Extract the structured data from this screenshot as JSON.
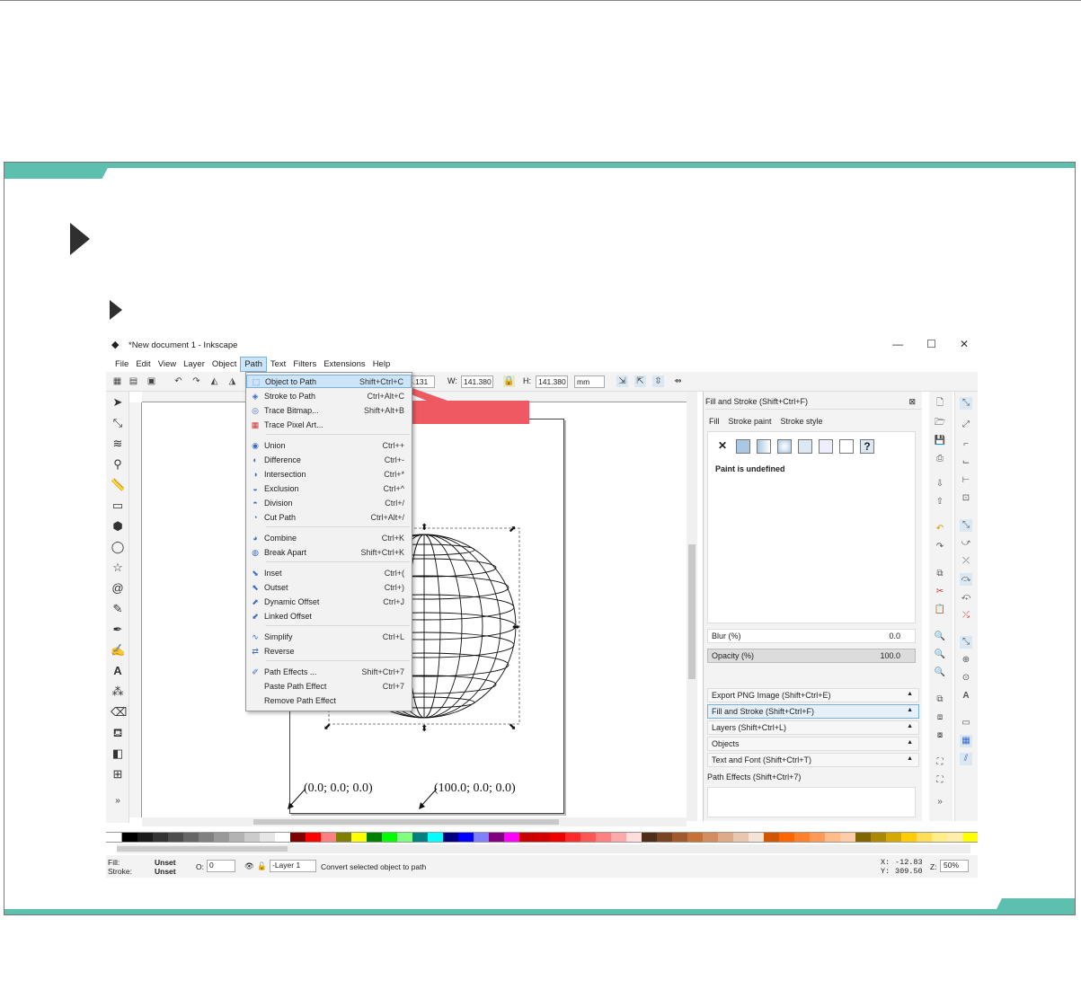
{
  "window": {
    "title": "*New document 1 - Inkscape",
    "controls": [
      "—",
      "☐",
      "✕"
    ]
  },
  "menubar": [
    "File",
    "Edit",
    "View",
    "Layer",
    "Object",
    "Path",
    "Text",
    "Filters",
    "Extensions",
    "Help"
  ],
  "toolbar": {
    "x_value": "5.131",
    "w_label": "W:",
    "w_value": "141.380",
    "h_label": "H:",
    "h_value": "141.380",
    "unit": "mm"
  },
  "path_menu": {
    "items": [
      {
        "label": "Object to Path",
        "shortcut": "Shift+Ctrl+C",
        "icon": "object-to-path-icon",
        "highlighted": true
      },
      {
        "label": "Stroke to Path",
        "shortcut": "Ctrl+Alt+C",
        "icon": "stroke-to-path-icon"
      },
      {
        "label": "Trace Bitmap...",
        "shortcut": "Shift+Alt+B",
        "icon": "trace-bitmap-icon"
      },
      {
        "label": "Trace Pixel Art...",
        "shortcut": "",
        "icon": "trace-pixel-art-icon"
      },
      {
        "label": "Union",
        "shortcut": "Ctrl++",
        "icon": "union-icon"
      },
      {
        "label": "Difference",
        "shortcut": "Ctrl+-",
        "icon": "difference-icon"
      },
      {
        "label": "Intersection",
        "shortcut": "Ctrl+*",
        "icon": "intersection-icon"
      },
      {
        "label": "Exclusion",
        "shortcut": "Ctrl+^",
        "icon": "exclusion-icon"
      },
      {
        "label": "Division",
        "shortcut": "Ctrl+/",
        "icon": "division-icon"
      },
      {
        "label": "Cut Path",
        "shortcut": "Ctrl+Alt+/",
        "icon": "cut-path-icon"
      },
      {
        "label": "Combine",
        "shortcut": "Ctrl+K",
        "icon": "combine-icon"
      },
      {
        "label": "Break Apart",
        "shortcut": "Shift+Ctrl+K",
        "icon": "break-apart-icon"
      },
      {
        "label": "Inset",
        "shortcut": "Ctrl+(",
        "icon": "inset-icon"
      },
      {
        "label": "Outset",
        "shortcut": "Ctrl+)",
        "icon": "outset-icon"
      },
      {
        "label": "Dynamic Offset",
        "shortcut": "Ctrl+J",
        "icon": "dynamic-offset-icon"
      },
      {
        "label": "Linked Offset",
        "shortcut": "",
        "icon": "linked-offset-icon"
      },
      {
        "label": "Simplify",
        "shortcut": "Ctrl+L",
        "icon": "simplify-icon"
      },
      {
        "label": "Reverse",
        "shortcut": "",
        "icon": "reverse-icon"
      },
      {
        "label": "Path Effects ...",
        "shortcut": "Shift+Ctrl+7",
        "icon": "path-effects-icon"
      },
      {
        "label": "Paste Path Effect",
        "shortcut": "Ctrl+7",
        "icon": ""
      },
      {
        "label": "Remove Path Effect",
        "shortcut": "",
        "icon": ""
      }
    ]
  },
  "canvas": {
    "coord_left": "(0.0; 0.0; 0.0)",
    "coord_right": "(100.0; 0.0; 0.0)"
  },
  "fill_stroke_panel": {
    "header": "Fill and Stroke (Shift+Ctrl+F)",
    "tabs": [
      "Fill",
      "Stroke paint",
      "Stroke style"
    ],
    "paint_status": "Paint is undefined",
    "blur_label": "Blur (%)",
    "blur_value": "0.0",
    "opacity_label": "Opacity (%)",
    "opacity_value": "100.0"
  },
  "docked_dialogs": [
    {
      "label": "Export PNG Image (Shift+Ctrl+E)",
      "active": false
    },
    {
      "label": "Fill and Stroke (Shift+Ctrl+F)",
      "active": true
    },
    {
      "label": "Layers (Shift+Ctrl+L)",
      "active": false
    },
    {
      "label": "Objects",
      "active": false
    },
    {
      "label": "Text and Font (Shift+Ctrl+T)",
      "active": false
    }
  ],
  "path_effects_panel": {
    "header": "Path Effects  (Shift+Ctrl+7)"
  },
  "statusbar": {
    "fill_label": "Fill:",
    "fill_value": "Unset",
    "stroke_label": "Stroke:",
    "stroke_value": "Unset",
    "opacity_label": "O:",
    "opacity_value": "0",
    "layer": "-Layer 1",
    "message": "Convert selected object to path",
    "x_label": "X:",
    "x_value": "-12.83",
    "y_label": "Y:",
    "y_value": "309.50",
    "zoom_label": "Z:",
    "zoom_value": "50%"
  },
  "colors": {
    "teal_accent": "#5dbfae",
    "callout_red": "#ef5a62",
    "menu_highlight": "#cce4f7"
  }
}
